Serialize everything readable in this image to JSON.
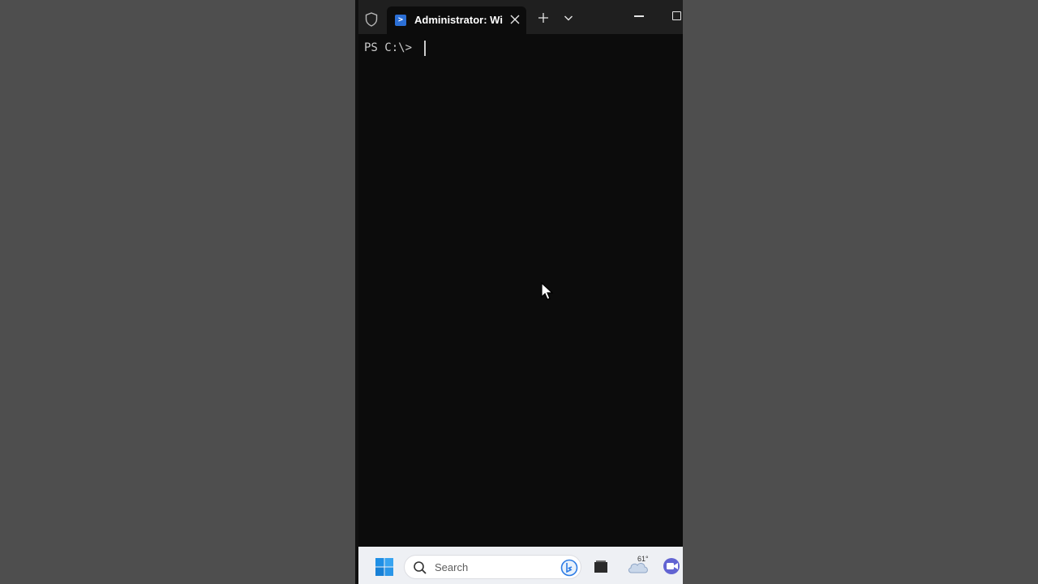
{
  "window": {
    "tab_title": "Administrator: Wi",
    "new_tab_symbol": "+",
    "icons": [
      "shield-icon",
      "powershell-icon",
      "close-icon",
      "plus-icon",
      "chevron-down-icon",
      "minimize-icon",
      "maximize-icon"
    ]
  },
  "terminal": {
    "prompt": "PS C:\\> ",
    "background": "#0c0c0c",
    "text_color": "#cccccc"
  },
  "taskbar": {
    "search_placeholder": "Search",
    "weather_temp": "61°",
    "icons": [
      "windows-start-icon",
      "search-icon",
      "bing-icon",
      "task-view-icon",
      "weather-icon",
      "teams-icon"
    ]
  },
  "colors": {
    "desktop_bg": "#4e4e4e",
    "titlebar_bg": "#1f1f1f",
    "taskbar_bg": "#eef0f4",
    "accent": "#2b6fd6"
  }
}
